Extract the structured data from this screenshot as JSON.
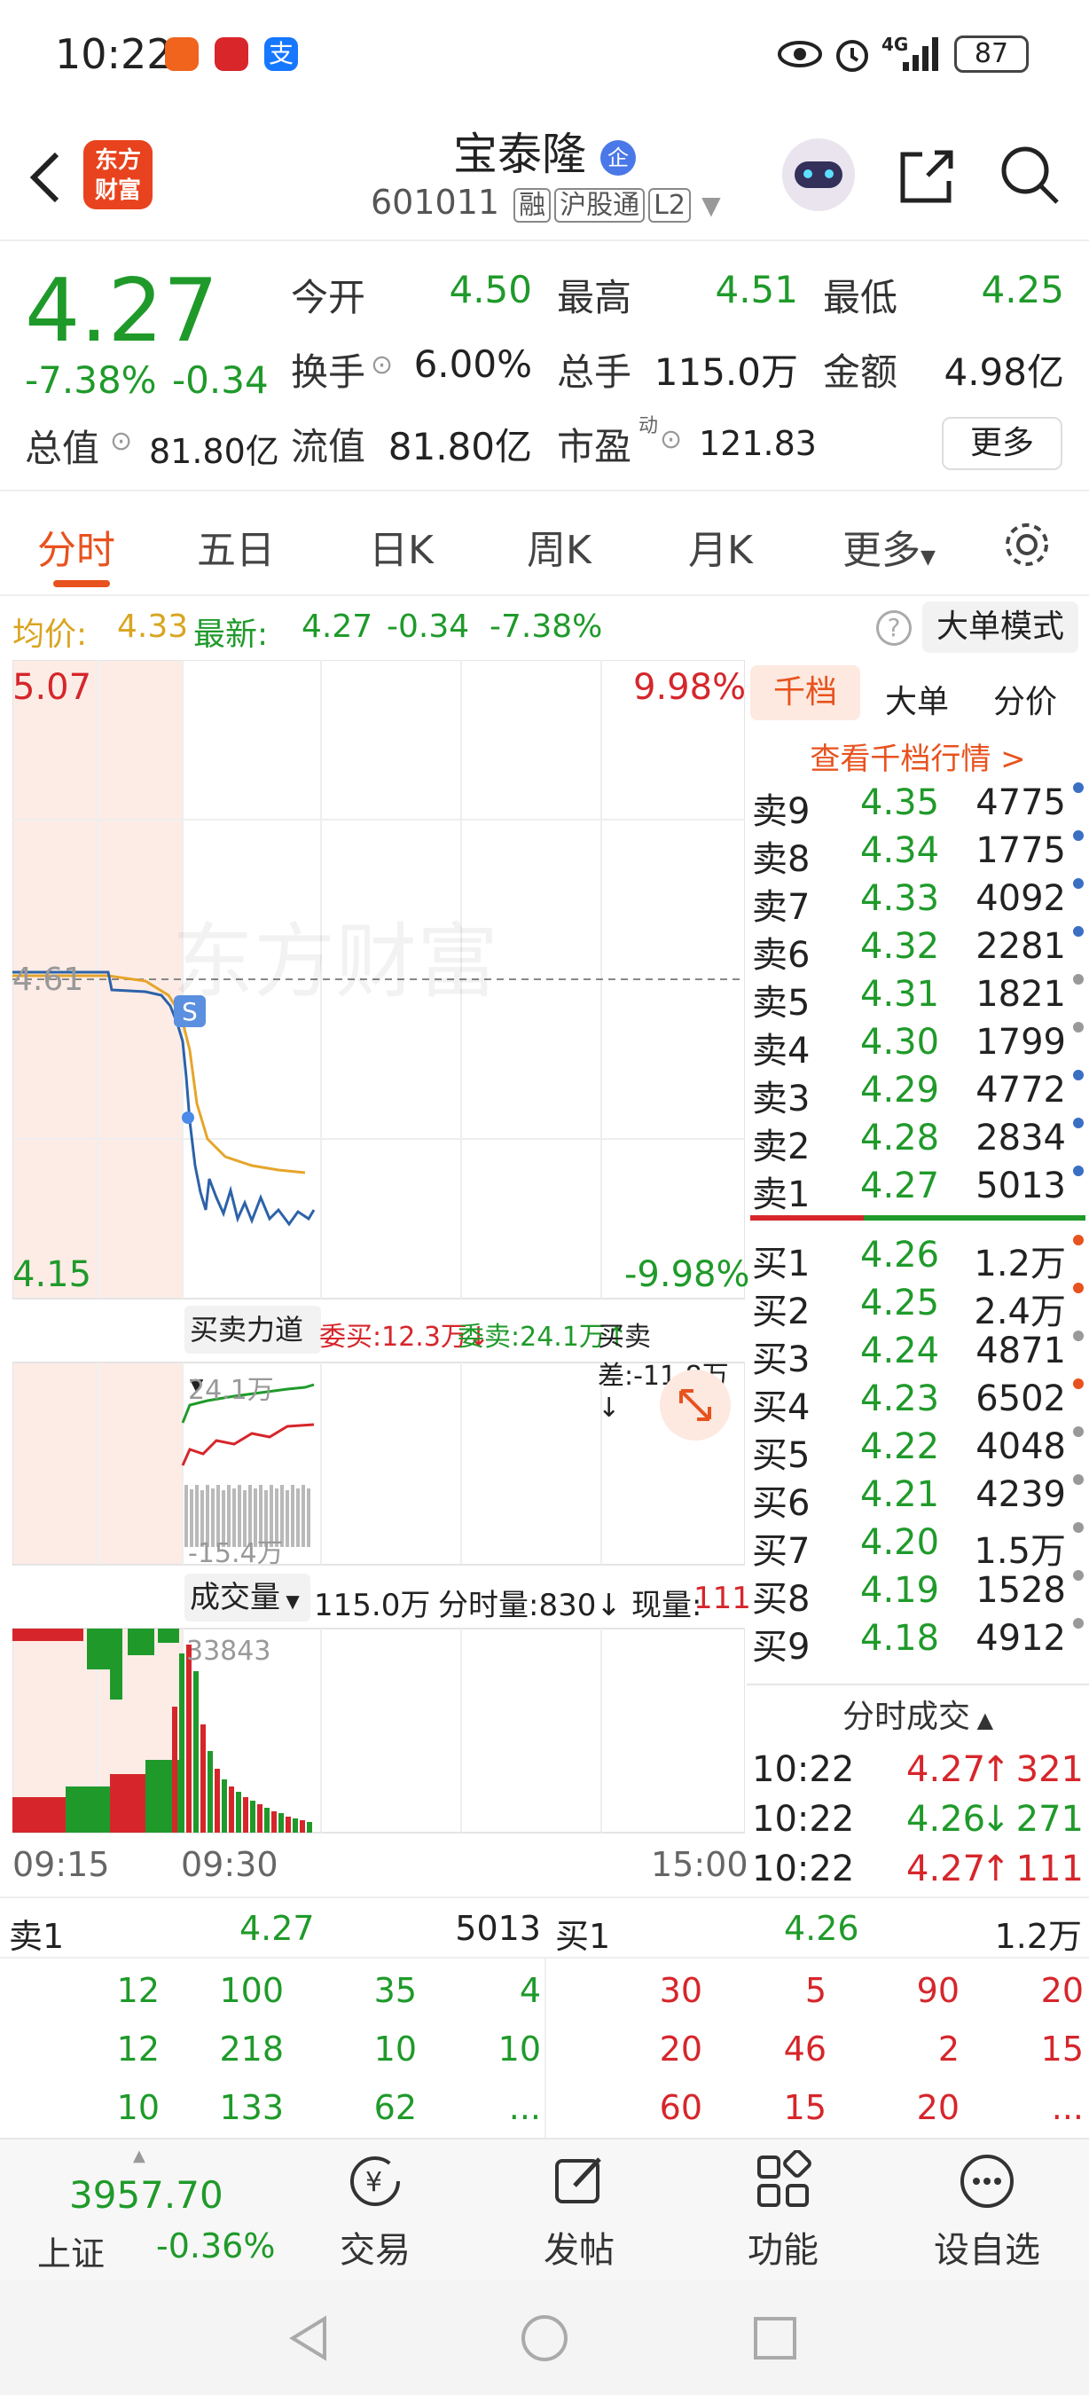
{
  "status_bar": {
    "time": "10:22",
    "network": "4G",
    "battery": "87"
  },
  "header": {
    "stock_name": "宝泰隆",
    "stock_code": "601011",
    "badges": [
      "融",
      "沪股通",
      "L2"
    ],
    "logo_text": "东方财富"
  },
  "quote": {
    "price": "4.27",
    "change_pct": "-7.38%",
    "change_amt": "-0.34",
    "open_label": "今开",
    "open": "4.50",
    "high_label": "最高",
    "high": "4.51",
    "low_label": "最低",
    "low": "4.25",
    "turnover_label": "换手",
    "turnover": "6.00%",
    "volume_label": "总手",
    "volume": "115.0万",
    "amount_label": "金额",
    "amount": "4.98亿",
    "mktcap_label": "总值",
    "mktcap": "81.80亿",
    "float_label": "流值",
    "float": "81.80亿",
    "pe_label": "市盈",
    "pe_sup": "动",
    "pe": "121.83",
    "more_label": "更多"
  },
  "tabs": [
    "分时",
    "五日",
    "日K",
    "周K",
    "月K",
    "更多"
  ],
  "info_line": {
    "avg_label": "均价:",
    "avg": "4.33",
    "latest_label": "最新:",
    "latest": "4.27",
    "chg": "-0.34",
    "pct": "-7.38%",
    "mode_btn": "大单模式"
  },
  "chart": {
    "y_top": "5.07",
    "y_pct_top": "9.98%",
    "y_ref": "4.61",
    "y_bottom": "4.15",
    "y_pct_bottom": "-9.98%",
    "watermark": "东方财富",
    "flag": "S",
    "force_label": "买卖力道",
    "force_buy": "委买:12.3万↓",
    "force_sell": "委卖:24.1万↑",
    "force_diff": "买卖差:-11.8万↓",
    "force_top": "24.1万",
    "force_bottom": "-15.4万",
    "vol_label": "成交量",
    "vol_total": "115.0万",
    "vol_minute": "分时量:830↓",
    "vol_now_label": "现量:",
    "vol_now": "111",
    "vol_peak": "33843",
    "times": [
      "09:15",
      "09:30",
      "15:00"
    ]
  },
  "order_book": {
    "tabs": [
      "千档",
      "大单",
      "分价"
    ],
    "link": "查看千档行情 >",
    "asks": [
      {
        "label": "卖9",
        "price": "4.35",
        "qty": "4775",
        "dot": "#3a6fc4"
      },
      {
        "label": "卖8",
        "price": "4.34",
        "qty": "1775",
        "dot": "#3a6fc4"
      },
      {
        "label": "卖7",
        "price": "4.33",
        "qty": "4092",
        "dot": "#3a6fc4"
      },
      {
        "label": "卖6",
        "price": "4.32",
        "qty": "2281",
        "dot": "#3a6fc4"
      },
      {
        "label": "卖5",
        "price": "4.31",
        "qty": "1821",
        "dot": "#999999"
      },
      {
        "label": "卖4",
        "price": "4.30",
        "qty": "1799",
        "dot": "#999999"
      },
      {
        "label": "卖3",
        "price": "4.29",
        "qty": "4772",
        "dot": "#3a6fc4"
      },
      {
        "label": "卖2",
        "price": "4.28",
        "qty": "2834",
        "dot": "#3a6fc4"
      },
      {
        "label": "卖1",
        "price": "4.27",
        "qty": "5013",
        "dot": "#3a6fc4"
      }
    ],
    "bids": [
      {
        "label": "买1",
        "price": "4.26",
        "qty": "1.2万",
        "dot": "#e8521e"
      },
      {
        "label": "买2",
        "price": "4.25",
        "qty": "2.4万",
        "dot": "#e8521e"
      },
      {
        "label": "买3",
        "price": "4.24",
        "qty": "4871",
        "dot": "#999999"
      },
      {
        "label": "买4",
        "price": "4.23",
        "qty": "6502",
        "dot": "#e8521e"
      },
      {
        "label": "买5",
        "price": "4.22",
        "qty": "4048",
        "dot": "#999999"
      },
      {
        "label": "买6",
        "price": "4.21",
        "qty": "4239",
        "dot": "#999999"
      },
      {
        "label": "买7",
        "price": "4.20",
        "qty": "1.5万",
        "dot": "#999999"
      },
      {
        "label": "买8",
        "price": "4.19",
        "qty": "1528",
        "dot": "#999999"
      },
      {
        "label": "买9",
        "price": "4.18",
        "qty": "4912",
        "dot": "#999999"
      }
    ],
    "trades_title": "分时成交",
    "trades": [
      {
        "time": "10:22",
        "price": "4.27",
        "dir": "↑",
        "qty": "321"
      },
      {
        "time": "10:22",
        "price": "4.26",
        "dir": "↓",
        "qty": "271"
      },
      {
        "time": "10:22",
        "price": "4.27",
        "dir": "↑",
        "qty": "111"
      }
    ]
  },
  "level2": {
    "sell_label": "卖1",
    "sell_price": "4.27",
    "sell_qty": "5013",
    "buy_label": "买1",
    "buy_price": "4.26",
    "buy_qty": "1.2万",
    "sell_rows": [
      [
        "12",
        "100",
        "35",
        "4"
      ],
      [
        "12",
        "218",
        "10",
        "10"
      ],
      [
        "10",
        "133",
        "62",
        "..."
      ]
    ],
    "buy_rows": [
      [
        "30",
        "5",
        "90",
        "20"
      ],
      [
        "20",
        "46",
        "2",
        "15"
      ],
      [
        "60",
        "15",
        "20",
        "..."
      ]
    ]
  },
  "bottom_nav": {
    "index_value": "3957.70",
    "index_name": "上证",
    "index_pct": "-0.36%",
    "items": [
      "交易",
      "发帖",
      "功能",
      "设自选"
    ]
  }
}
